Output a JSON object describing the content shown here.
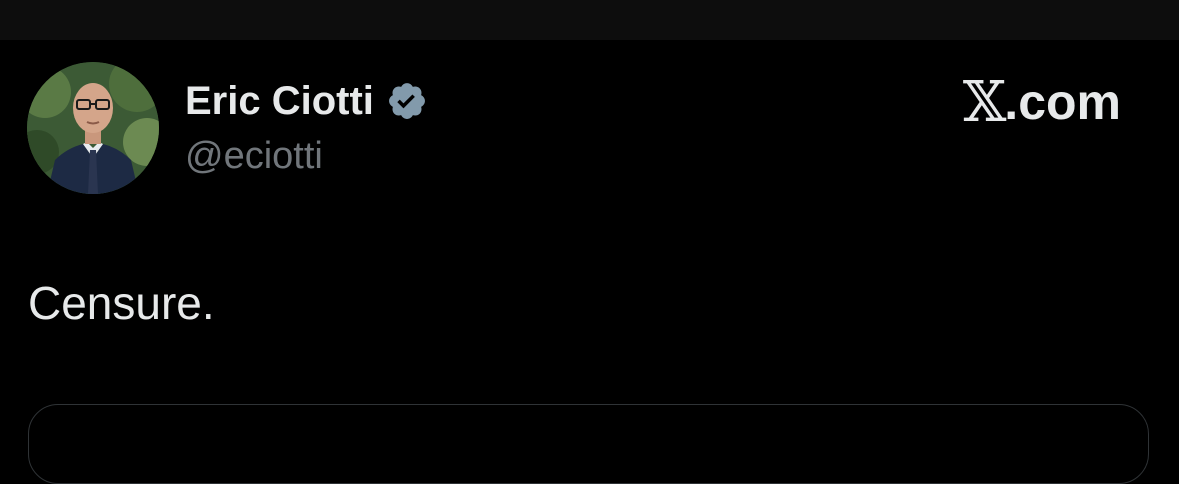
{
  "tweet": {
    "author": {
      "display_name": "Eric Ciotti",
      "handle": "@eciotti",
      "verified": true,
      "avatar": "profile-photo"
    },
    "brand_label": "X.com",
    "text": "Censure."
  },
  "colors": {
    "background": "#000000",
    "top_bar": "#0d0d0d",
    "primary_text": "#e7e9ea",
    "secondary_text": "#71767b",
    "verified_badge": "#829aab",
    "card_border": "#2f3336"
  },
  "icons": {
    "verified": "verified-badge-icon",
    "brand": "x-logo-icon"
  }
}
